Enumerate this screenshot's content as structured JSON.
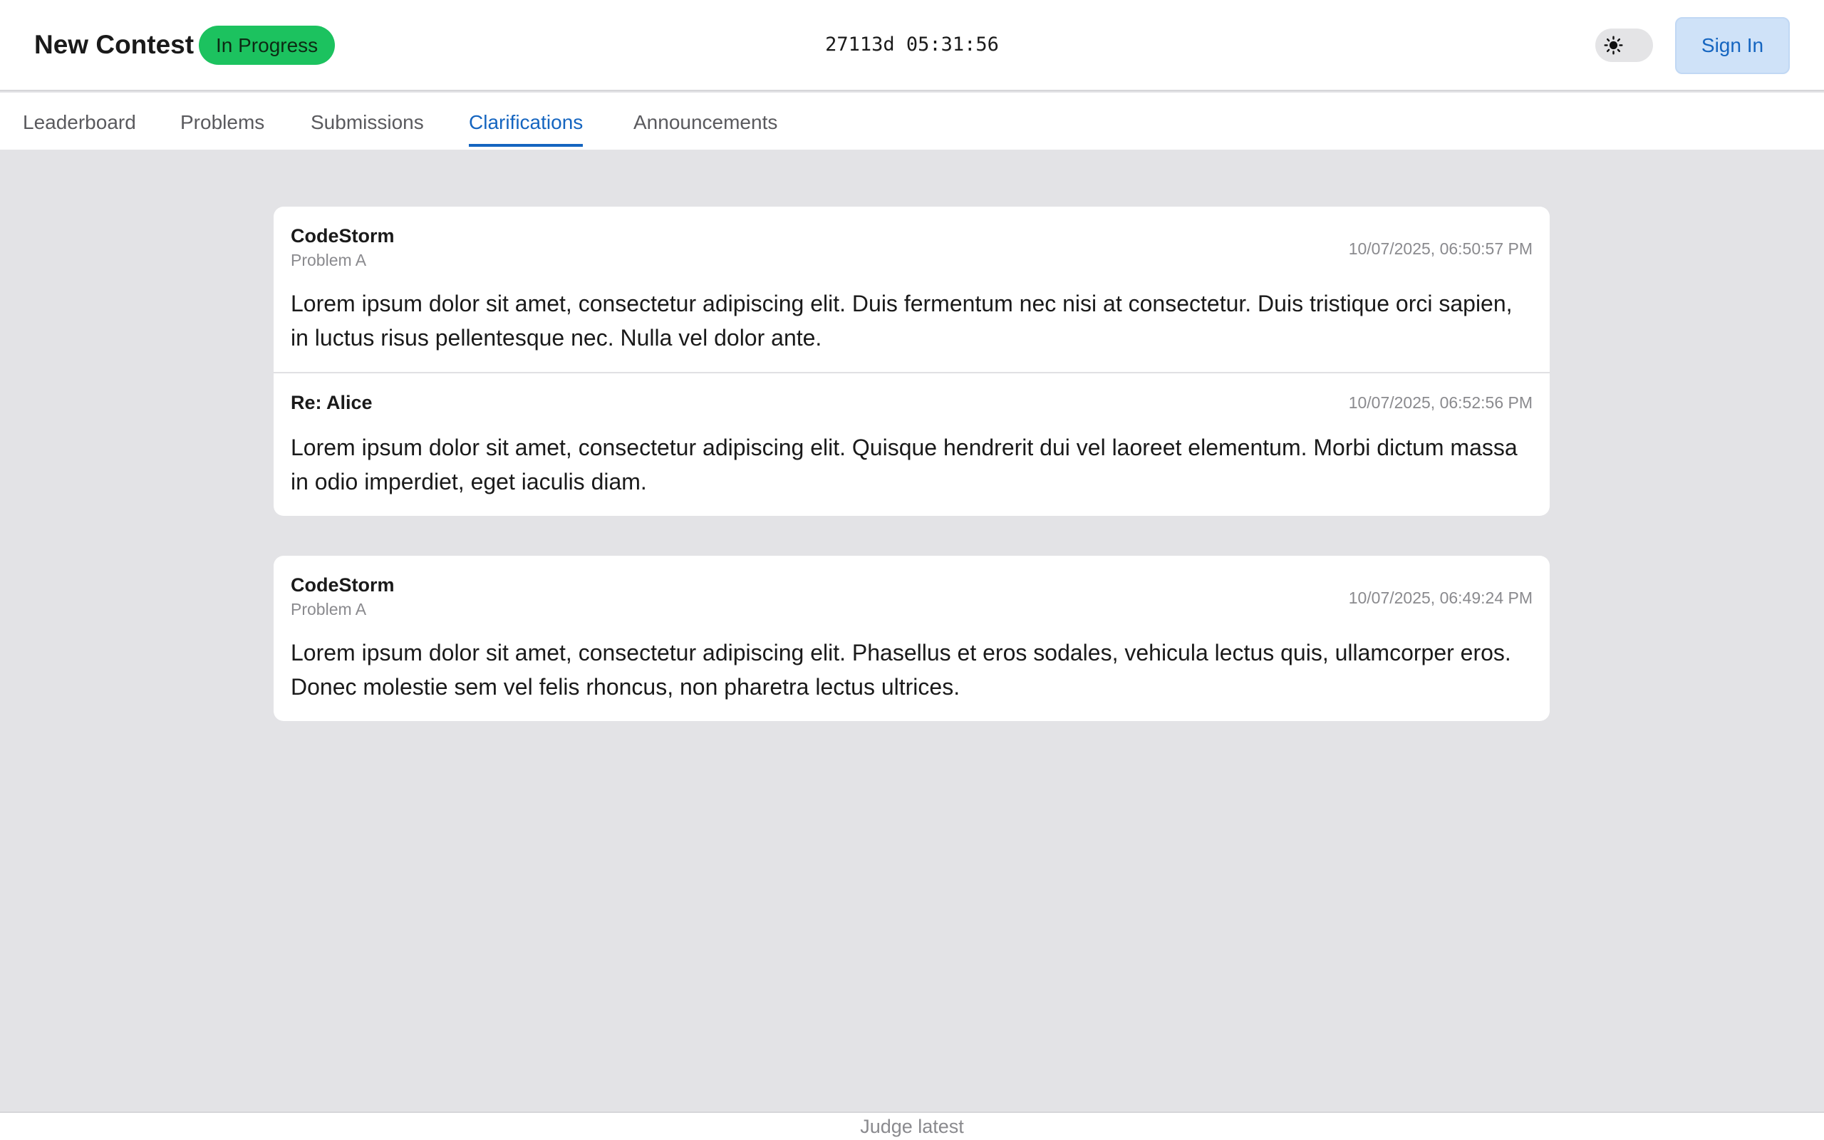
{
  "header": {
    "title": "New Contest",
    "status": "In Progress",
    "timer": "27113d 05:31:56",
    "theme_icon": "sun-icon",
    "signin_label": "Sign In"
  },
  "tabs": [
    {
      "label": "Leaderboard"
    },
    {
      "label": "Problems"
    },
    {
      "label": "Submissions"
    },
    {
      "label": "Clarifications"
    },
    {
      "label": "Announcements"
    }
  ],
  "active_tab": "Clarifications",
  "clarifications": [
    {
      "author": "CodeStorm",
      "problem": "Problem A",
      "time": "10/07/2025, 06:50:57 PM",
      "text": "Lorem ipsum dolor sit amet, consectetur adipiscing elit. Duis fermentum nec nisi at consectetur. Duis tristique orci sapien, in luctus risus pellentesque nec. Nulla vel dolor ante.",
      "reply": {
        "author": "Re: Alice",
        "time": "10/07/2025, 06:52:56 PM",
        "text": "Lorem ipsum dolor sit amet, consectetur adipiscing elit. Quisque hendrerit dui vel laoreet elementum. Morbi dictum massa in odio imperdiet, eget iaculis diam."
      }
    },
    {
      "author": "CodeStorm",
      "problem": "Problem A",
      "time": "10/07/2025, 06:49:24 PM",
      "text": "Lorem ipsum dolor sit amet, consectetur adipiscing elit. Phasellus et eros sodales, vehicula lectus quis, ullamcorper eros. Donec molestie sem vel felis rhoncus, non pharetra lectus ultrices."
    }
  ],
  "footer": {
    "text": "Judge latest"
  },
  "colors": {
    "accent": "#1565c0",
    "status": "#1cc25f",
    "background": "#e3e3e6"
  }
}
